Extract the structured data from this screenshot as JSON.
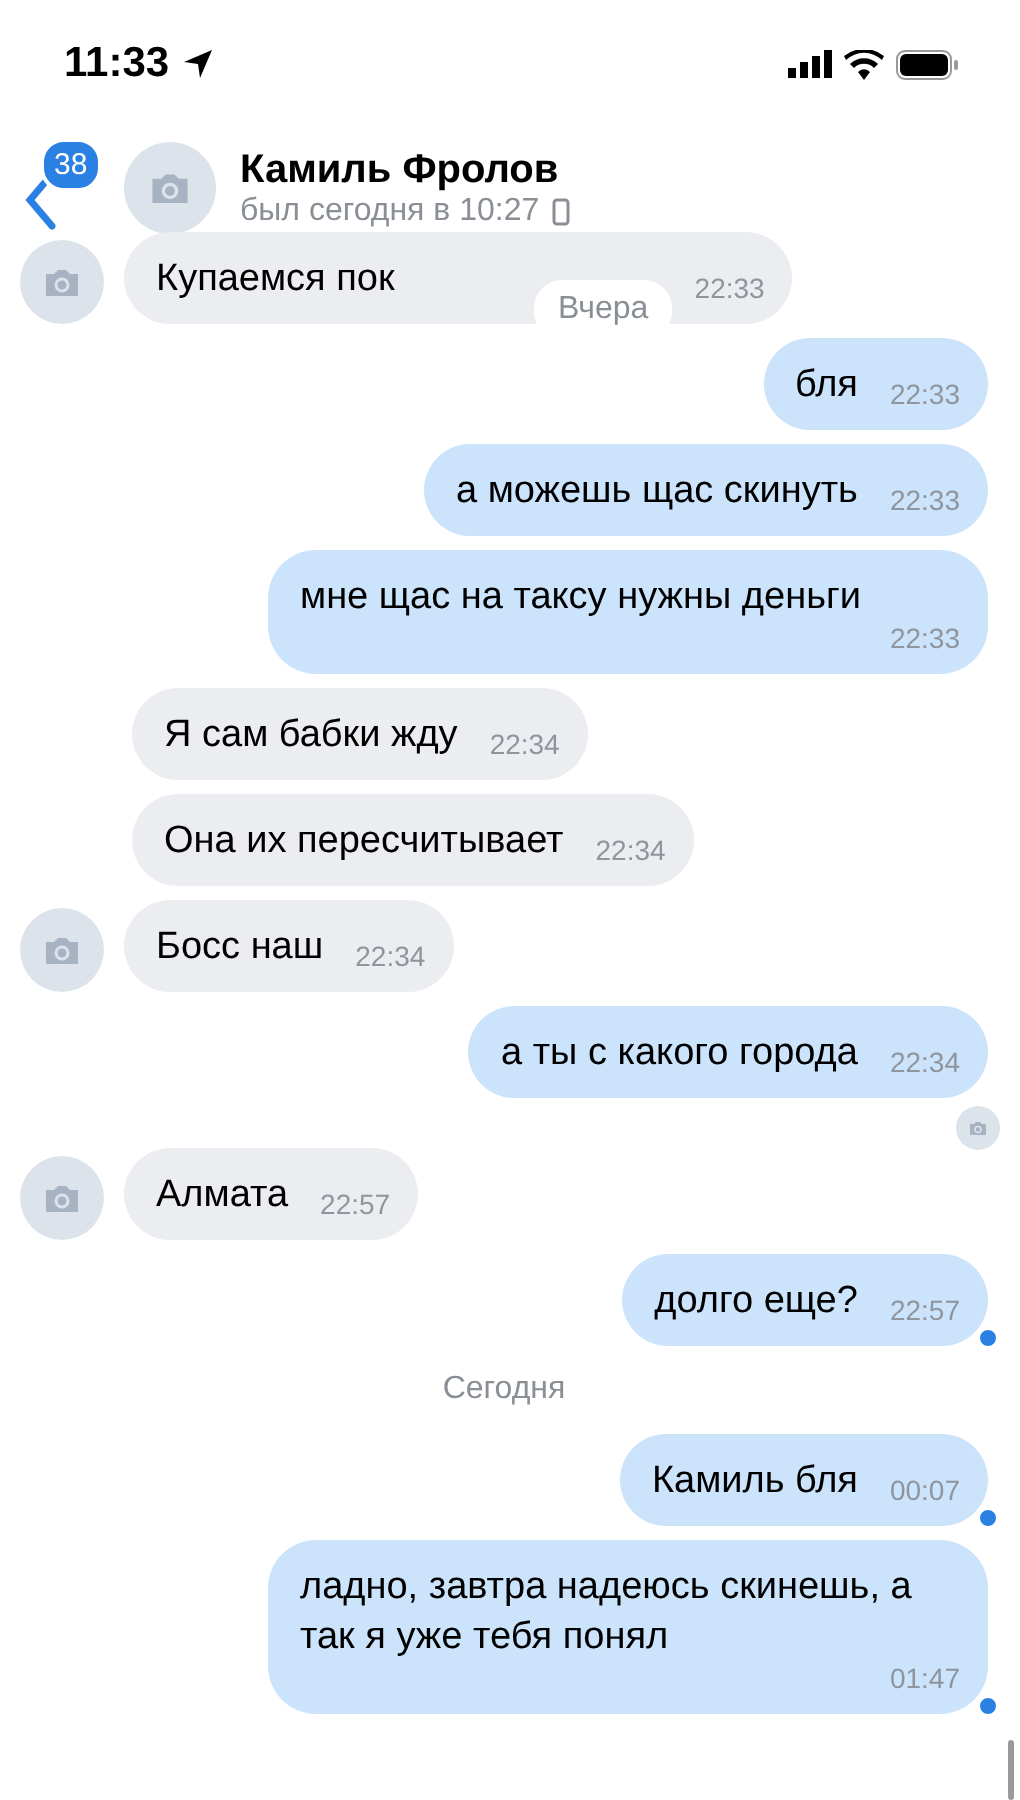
{
  "status_bar": {
    "time": "11:33"
  },
  "header": {
    "badge": "38",
    "name": "Камиль Фролов",
    "last_seen": "был сегодня в 10:27"
  },
  "messages": [
    {
      "kind": "in",
      "text": "Купаемся пок",
      "time": "22:33",
      "avatar": true,
      "date_overlay": "Вчера"
    },
    {
      "kind": "out",
      "text": "бля",
      "time": "22:33"
    },
    {
      "kind": "out",
      "text": "а можешь щас скинуть",
      "time": "22:33"
    },
    {
      "kind": "out",
      "text": "мне щас на таксу нужны деньги",
      "time": "22:33"
    },
    {
      "kind": "in",
      "text": "Я сам бабки жду",
      "time": "22:34",
      "avatar": false
    },
    {
      "kind": "in",
      "text": "Она их пересчитывает",
      "time": "22:34",
      "avatar": false
    },
    {
      "kind": "in",
      "text": "Босс наш",
      "time": "22:34",
      "avatar": true
    },
    {
      "kind": "out",
      "text": "а ты с какого города",
      "time": "22:34",
      "read_mark": true
    },
    {
      "kind": "in",
      "text": "Алмата",
      "time": "22:57",
      "avatar": true
    },
    {
      "kind": "out",
      "text": "долго еще?",
      "time": "22:57",
      "unread": true
    },
    {
      "kind": "date",
      "text": "Сегодня"
    },
    {
      "kind": "out",
      "text": "Камиль бля",
      "time": "00:07",
      "unread": true
    },
    {
      "kind": "out",
      "text": "ладно, завтра надеюсь скинешь, а так я уже тебя понял",
      "time": "01:47",
      "unread": true
    }
  ]
}
